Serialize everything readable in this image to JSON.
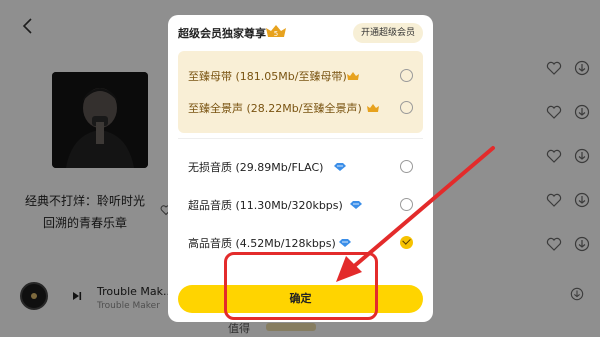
{
  "background": {
    "album_title_line1": "经典不打烊：聆听时光",
    "album_title_line2": "回溯的青春乐章",
    "mini_player": {
      "title": "Trouble Mak...",
      "artist": "Trouble Maker"
    },
    "bottom_peek_text": "值得"
  },
  "modal": {
    "title": "超级会员独家尊享",
    "badge_text": "5",
    "open_button_label": "开通超级会员",
    "svip_options": [
      {
        "label": "至臻母带  (181.05Mb/至臻母带)",
        "icon": "svip-crown-icon",
        "selected": false
      },
      {
        "label": "至臻全景声  (28.22Mb/至臻全景声)",
        "icon": "svip-crown-icon",
        "selected": false
      }
    ],
    "std_options": [
      {
        "label": "无损音质  (29.89Mb/FLAC)",
        "icon": "vip-diamond-icon",
        "selected": false
      },
      {
        "label": "超品音质  (11.30Mb/320kbps)",
        "icon": "vip-diamond-icon",
        "selected": false
      },
      {
        "label": "高品音质  (4.52Mb/128kbps)",
        "icon": "vip-diamond-icon",
        "selected": true
      }
    ],
    "confirm_label": "确定"
  },
  "colors": {
    "accent_yellow": "#ffd400",
    "svip_bg": "#f9efd6",
    "annotation_red": "#e32b2b"
  }
}
